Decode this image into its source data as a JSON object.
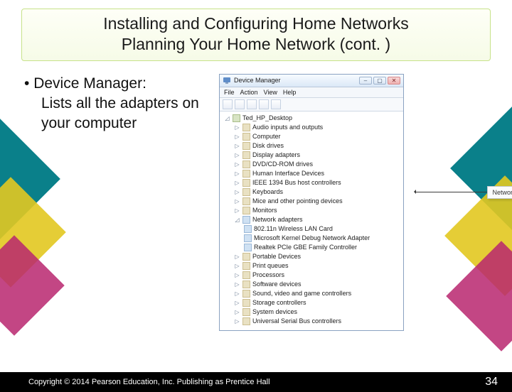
{
  "title": {
    "line1": "Installing and Configuring Home Networks",
    "line2": "Planning Your Home Network (cont. )"
  },
  "bullet": {
    "lead": "Device Manager:",
    "rest": "Lists all the adapters on your computer"
  },
  "dm": {
    "window_title": "Device Manager",
    "menu": {
      "file": "File",
      "action": "Action",
      "view": "View",
      "help": "Help"
    },
    "root": "Ted_HP_Desktop",
    "categories": [
      "Audio inputs and outputs",
      "Computer",
      "Disk drives",
      "Display adapters",
      "DVD/CD-ROM drives",
      "Human Interface Devices",
      "IEEE 1394 Bus host controllers",
      "Keyboards",
      "Mice and other pointing devices",
      "Monitors"
    ],
    "net_label": "Network adapters",
    "net_children": [
      "802.11n Wireless LAN Card",
      "Microsoft Kernel Debug Network Adapter",
      "Realtek PCIe GBE Family Controller"
    ],
    "categories_after": [
      "Portable Devices",
      "Print queues",
      "Processors",
      "Software devices",
      "Sound, video and game controllers",
      "Storage controllers",
      "System devices",
      "Universal Serial Bus controllers"
    ]
  },
  "callout_label": "Network adapters",
  "footer": {
    "copyright": "Copyright © 2014 Pearson Education, Inc. Publishing as Prentice Hall",
    "page": "34"
  }
}
